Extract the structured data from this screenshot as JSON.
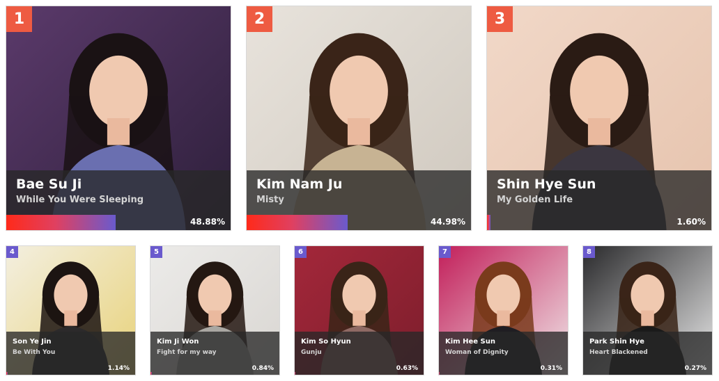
{
  "rankings": [
    {
      "rank": "1",
      "name": "Bae Su Ji",
      "drama": "While You Were Sleeping",
      "percent_label": "48.88%",
      "percent": 48.88,
      "bg": "#5b3a6b",
      "bg2": "#2d1f3a",
      "hair": "#1a1214",
      "top": "#6a6fb0"
    },
    {
      "rank": "2",
      "name": "Kim Nam Ju",
      "drama": "Misty",
      "percent_label": "44.98%",
      "percent": 44.98,
      "bg": "#e8e3dc",
      "bg2": "#cfc8be",
      "hair": "#3a2418",
      "top": "#c7b393"
    },
    {
      "rank": "3",
      "name": "Shin Hye Sun",
      "drama": "My Golden Life",
      "percent_label": "1.60%",
      "percent": 1.6,
      "bg": "#f1d8c8",
      "bg2": "#e6c3ad",
      "hair": "#2a1b14",
      "top": "#3b3640"
    },
    {
      "rank": "4",
      "name": "Son Ye Jin",
      "drama": "Be With You",
      "percent_label": "1.14%",
      "percent": 1.14,
      "bg": "#f3efe0",
      "bg2": "#e8d27a",
      "hair": "#1c1412",
      "top": "#2c2a2b"
    },
    {
      "rank": "5",
      "name": "Kim Ji Won",
      "drama": "Fight for my way",
      "percent_label": "0.84%",
      "percent": 0.84,
      "bg": "#ecebe9",
      "bg2": "#d9d6d2",
      "hair": "#241812",
      "top": "#a9a7a2"
    },
    {
      "rank": "6",
      "name": "Kim So Hyun",
      "drama": "Gunju",
      "percent_label": "0.63%",
      "percent": 0.63,
      "bg": "#a3273a",
      "bg2": "#7d1e2c",
      "hair": "#3a2418",
      "top": "#8f6a64"
    },
    {
      "rank": "7",
      "name": "Kim Hee Sun",
      "drama": "Woman of Dignity",
      "percent_label": "0.31%",
      "percent": 0.31,
      "bg": "#c21f5a",
      "bg2": "#f0e6e8",
      "hair": "#7a3b1c",
      "top": "#1f1d22"
    },
    {
      "rank": "8",
      "name": "Park Shin Hye",
      "drama": "Heart Blackened",
      "percent_label": "0.27%",
      "percent": 0.27,
      "bg": "#2a2a2c",
      "bg2": "#e9e9e9",
      "hair": "#3a2418",
      "top": "#1a1a1a"
    }
  ]
}
